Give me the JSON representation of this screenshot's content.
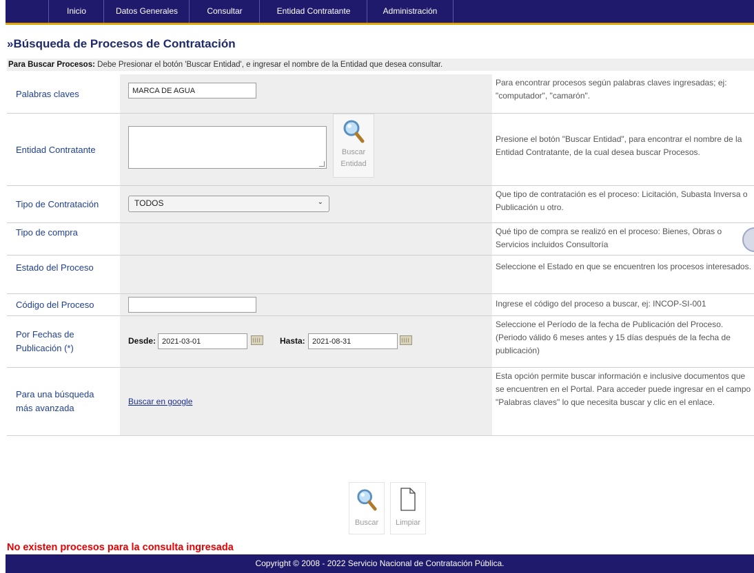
{
  "nav": {
    "items": [
      "Inicio",
      "Datos Generales",
      "Consultar",
      "Entidad Contratante",
      "Administración"
    ]
  },
  "page": {
    "title": "»Búsqueda de Procesos de Contratación",
    "instruction_bold": "Para Buscar Procesos:",
    "instruction_text": " Debe Presionar el botón 'Buscar Entidad', e ingresar el nombre de la Entidad que desea consultar."
  },
  "form": {
    "keywords": {
      "label": "Palabras claves",
      "value": "MARCA DE AGUA",
      "help": "Para encontrar procesos según palabras claves ingresadas; ej: \"computador\", \"camarón\"."
    },
    "entity": {
      "label": "Entidad Contratante",
      "value": "",
      "button_line1": "Buscar",
      "button_line2": "Entidad",
      "help": "Presione el botón \"Buscar Entidad\", para encontrar el nombre de la Entidad Contratante, de la cual desea buscar Procesos."
    },
    "contract_type": {
      "label": "Tipo de Contratación",
      "selected": "TODOS",
      "help": "Que tipo de contratación es el proceso: Licitación, Subasta Inversa o Publicación u otro."
    },
    "purchase_type": {
      "label": "Tipo de compra",
      "help": "Qué tipo de compra se realizó en el proceso: Bienes, Obras o Servicios incluidos Consultoría"
    },
    "status": {
      "label": "Estado del Proceso",
      "help": "Seleccione el Estado en que se encuentren los procesos interesados."
    },
    "code": {
      "label": "Código del Proceso",
      "value": "",
      "help": "Ingrese el código del proceso a buscar, ej: INCOP-SI-001"
    },
    "dates": {
      "label": "Por Fechas de Publicación (*)",
      "from_label": "Desde:",
      "from_value": "2021-03-01",
      "to_label": "Hasta:",
      "to_value": "2021-08-31",
      "help": "Seleccione el Período de la fecha de Publicación del Proceso. (Periodo válido 6 meses antes y 15 días después de la fecha de publicación)"
    },
    "advanced": {
      "label": "Para una búsqueda más avanzada",
      "link": "Buscar en google",
      "help": "Esta opción permite buscar información e inclusive documentos que se encuentren en el Portal. Para acceder puede ingresar en el campo \"Palabras claves\" lo que necesita buscar y clic en el enlace."
    }
  },
  "actions": {
    "search_label": "Buscar",
    "clear_label": "Limpiar"
  },
  "result_message": "No existen procesos para la consulta ingresada",
  "footer": "Copyright © 2008 - 2022 Servicio Nacional de Contratación Pública."
}
